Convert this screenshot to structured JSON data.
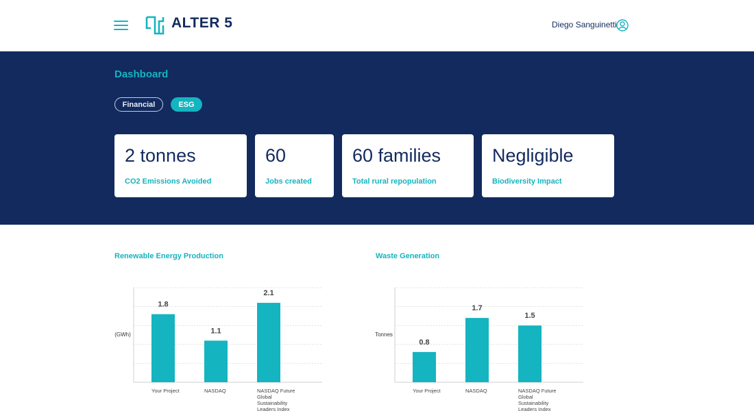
{
  "header": {
    "brand": "ALTER 5",
    "user_name": "Diego Sanguinetti"
  },
  "dashboard": {
    "title": "Dashboard",
    "tabs": [
      {
        "label": "Financial",
        "active": false
      },
      {
        "label": "ESG",
        "active": true
      }
    ],
    "kpis": [
      {
        "value": "2 tonnes",
        "label": "CO2 Emissions Avoided"
      },
      {
        "value": "60",
        "label": "Jobs created"
      },
      {
        "value": "60 families",
        "label": "Total rural repopulation"
      },
      {
        "value": "Negligible",
        "label": "Biodiversity Impact"
      }
    ]
  },
  "colors": {
    "navy": "#122a5e",
    "teal": "#14b4c0"
  },
  "chart_data": [
    {
      "type": "bar",
      "title": "Renewable Energy Production",
      "ylabel": "(GWh)",
      "categories": [
        "Your Project",
        "NASDAQ",
        "NASDAQ Future Global Sustainability Leaders Index"
      ],
      "values": [
        1.8,
        1.1,
        2.1
      ],
      "value_labels": [
        "1.8",
        "1.1",
        "2.1"
      ],
      "ylim": [
        0,
        2.5
      ],
      "grid": true,
      "color": "#14b4c0"
    },
    {
      "type": "bar",
      "title": "Waste Generation",
      "ylabel": "Tonnes",
      "categories": [
        "Your Project",
        "NASDAQ",
        "NASDAQ Future Global Sustainability Leaders Index"
      ],
      "values": [
        0.8,
        1.7,
        1.5
      ],
      "value_labels": [
        "0.8",
        "1.7",
        "1.5"
      ],
      "ylim": [
        0,
        2.5
      ],
      "grid": true,
      "color": "#14b4c0"
    }
  ]
}
